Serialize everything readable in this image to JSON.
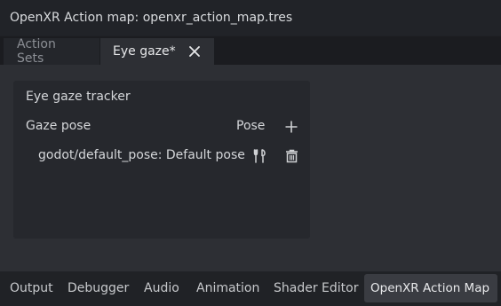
{
  "window": {
    "title": "OpenXR Action map: openxr_action_map.tres"
  },
  "tabs": [
    {
      "label": "Action Sets",
      "active": false
    },
    {
      "label": "Eye gaze*",
      "active": true
    }
  ],
  "action_set": {
    "name": "Eye gaze tracker",
    "action": {
      "name": "Gaze pose",
      "type": "Pose"
    },
    "binding": {
      "label": "godot/default_pose: Default pose"
    }
  },
  "bottom_panel": {
    "tabs": [
      "Output",
      "Debugger",
      "Audio",
      "Animation",
      "Shader Editor",
      "OpenXR Action Map"
    ],
    "selected": "OpenXR Action Map"
  },
  "icons": {
    "tab_close": "close-icon",
    "add_action": "plus-icon",
    "edit_binding": "tools-icon",
    "delete_binding": "trash-icon"
  },
  "colors": {
    "background": "#202226",
    "panel": "#2d2f34",
    "action_set_bg": "#26282d",
    "text": "#d4d6d9",
    "muted_text": "#8c8f95"
  }
}
